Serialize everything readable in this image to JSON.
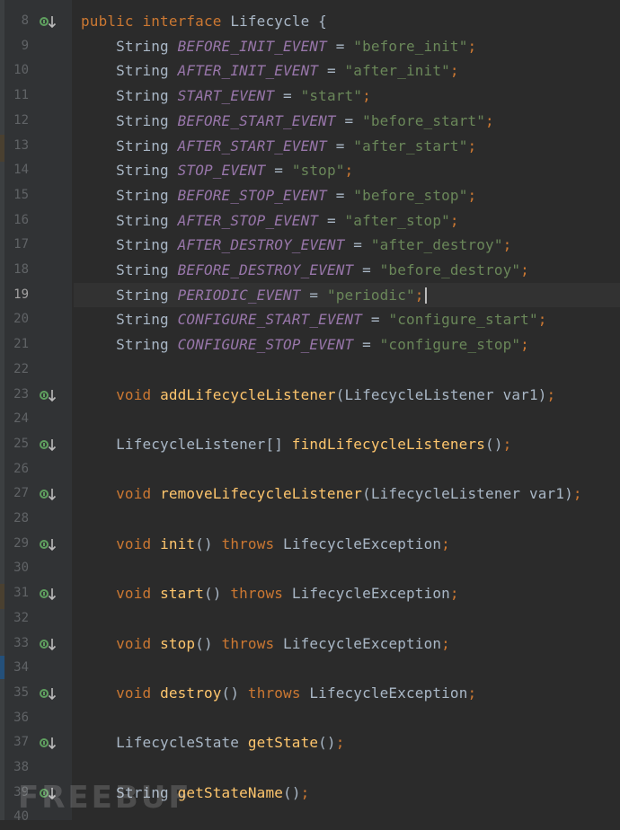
{
  "editor": {
    "current_line": "19",
    "lines": [
      {
        "num": "8",
        "marker": true,
        "tokens": [
          [
            "k",
            "public interface "
          ],
          [
            "t",
            "Lifecycle {"
          ]
        ]
      },
      {
        "num": "9",
        "tokens": [
          [
            "t",
            "    String "
          ],
          [
            "c",
            "BEFORE_INIT_EVENT"
          ],
          [
            "t",
            " = "
          ],
          [
            "s",
            "\"before_init\""
          ],
          [
            "p",
            ";"
          ]
        ]
      },
      {
        "num": "10",
        "tokens": [
          [
            "t",
            "    String "
          ],
          [
            "c",
            "AFTER_INIT_EVENT"
          ],
          [
            "t",
            " = "
          ],
          [
            "s",
            "\"after_init\""
          ],
          [
            "p",
            ";"
          ]
        ]
      },
      {
        "num": "11",
        "tokens": [
          [
            "t",
            "    String "
          ],
          [
            "c",
            "START_EVENT"
          ],
          [
            "t",
            " = "
          ],
          [
            "s",
            "\"start\""
          ],
          [
            "p",
            ";"
          ]
        ]
      },
      {
        "num": "12",
        "tokens": [
          [
            "t",
            "    String "
          ],
          [
            "c",
            "BEFORE_START_EVENT"
          ],
          [
            "t",
            " = "
          ],
          [
            "s",
            "\"before_start\""
          ],
          [
            "p",
            ";"
          ]
        ]
      },
      {
        "num": "13",
        "tokens": [
          [
            "t",
            "    String "
          ],
          [
            "c",
            "AFTER_START_EVENT"
          ],
          [
            "t",
            " = "
          ],
          [
            "s",
            "\"after_start\""
          ],
          [
            "p",
            ";"
          ]
        ]
      },
      {
        "num": "14",
        "tokens": [
          [
            "t",
            "    String "
          ],
          [
            "c",
            "STOP_EVENT"
          ],
          [
            "t",
            " = "
          ],
          [
            "s",
            "\"stop\""
          ],
          [
            "p",
            ";"
          ]
        ]
      },
      {
        "num": "15",
        "tokens": [
          [
            "t",
            "    String "
          ],
          [
            "c",
            "BEFORE_STOP_EVENT"
          ],
          [
            "t",
            " = "
          ],
          [
            "s",
            "\"before_stop\""
          ],
          [
            "p",
            ";"
          ]
        ]
      },
      {
        "num": "16",
        "tokens": [
          [
            "t",
            "    String "
          ],
          [
            "c",
            "AFTER_STOP_EVENT"
          ],
          [
            "t",
            " = "
          ],
          [
            "s",
            "\"after_stop\""
          ],
          [
            "p",
            ";"
          ]
        ]
      },
      {
        "num": "17",
        "tokens": [
          [
            "t",
            "    String "
          ],
          [
            "c",
            "AFTER_DESTROY_EVENT"
          ],
          [
            "t",
            " = "
          ],
          [
            "s",
            "\"after_destroy\""
          ],
          [
            "p",
            ";"
          ]
        ]
      },
      {
        "num": "18",
        "tokens": [
          [
            "t",
            "    String "
          ],
          [
            "c",
            "BEFORE_DESTROY_EVENT"
          ],
          [
            "t",
            " = "
          ],
          [
            "s",
            "\"before_destroy\""
          ],
          [
            "p",
            ";"
          ]
        ]
      },
      {
        "num": "19",
        "tokens": [
          [
            "t",
            "    String "
          ],
          [
            "c",
            "PERIODIC_EVENT"
          ],
          [
            "t",
            " = "
          ],
          [
            "s",
            "\"periodic\""
          ],
          [
            "p",
            ";"
          ]
        ]
      },
      {
        "num": "20",
        "tokens": [
          [
            "t",
            "    String "
          ],
          [
            "c",
            "CONFIGURE_START_EVENT"
          ],
          [
            "t",
            " = "
          ],
          [
            "s",
            "\"configure_start\""
          ],
          [
            "p",
            ";"
          ]
        ]
      },
      {
        "num": "21",
        "tokens": [
          [
            "t",
            "    String "
          ],
          [
            "c",
            "CONFIGURE_STOP_EVENT"
          ],
          [
            "t",
            " = "
          ],
          [
            "s",
            "\"configure_stop\""
          ],
          [
            "p",
            ";"
          ]
        ]
      },
      {
        "num": "22",
        "tokens": []
      },
      {
        "num": "23",
        "marker": true,
        "tokens": [
          [
            "t",
            "    "
          ],
          [
            "k",
            "void "
          ],
          [
            "m",
            "addLifecycleListener"
          ],
          [
            "t",
            "(LifecycleListener var1)"
          ],
          [
            "p",
            ";"
          ]
        ]
      },
      {
        "num": "24",
        "tokens": []
      },
      {
        "num": "25",
        "marker": true,
        "tokens": [
          [
            "t",
            "    LifecycleListener[] "
          ],
          [
            "m",
            "findLifecycleListeners"
          ],
          [
            "t",
            "()"
          ],
          [
            "p",
            ";"
          ]
        ]
      },
      {
        "num": "26",
        "tokens": []
      },
      {
        "num": "27",
        "marker": true,
        "tokens": [
          [
            "t",
            "    "
          ],
          [
            "k",
            "void "
          ],
          [
            "m",
            "removeLifecycleListener"
          ],
          [
            "t",
            "(LifecycleListener var1)"
          ],
          [
            "p",
            ";"
          ]
        ]
      },
      {
        "num": "28",
        "tokens": []
      },
      {
        "num": "29",
        "marker": true,
        "tokens": [
          [
            "t",
            "    "
          ],
          [
            "k",
            "void "
          ],
          [
            "m",
            "init"
          ],
          [
            "t",
            "() "
          ],
          [
            "k",
            "throws "
          ],
          [
            "t",
            "LifecycleException"
          ],
          [
            "p",
            ";"
          ]
        ]
      },
      {
        "num": "30",
        "tokens": []
      },
      {
        "num": "31",
        "marker": true,
        "tokens": [
          [
            "t",
            "    "
          ],
          [
            "k",
            "void "
          ],
          [
            "m",
            "start"
          ],
          [
            "t",
            "() "
          ],
          [
            "k",
            "throws "
          ],
          [
            "t",
            "LifecycleException"
          ],
          [
            "p",
            ";"
          ]
        ]
      },
      {
        "num": "32",
        "tokens": []
      },
      {
        "num": "33",
        "marker": true,
        "tokens": [
          [
            "t",
            "    "
          ],
          [
            "k",
            "void "
          ],
          [
            "m",
            "stop"
          ],
          [
            "t",
            "() "
          ],
          [
            "k",
            "throws "
          ],
          [
            "t",
            "LifecycleException"
          ],
          [
            "p",
            ";"
          ]
        ]
      },
      {
        "num": "34",
        "tokens": []
      },
      {
        "num": "35",
        "marker": true,
        "tokens": [
          [
            "t",
            "    "
          ],
          [
            "k",
            "void "
          ],
          [
            "m",
            "destroy"
          ],
          [
            "t",
            "() "
          ],
          [
            "k",
            "throws "
          ],
          [
            "t",
            "LifecycleException"
          ],
          [
            "p",
            ";"
          ]
        ]
      },
      {
        "num": "36",
        "tokens": []
      },
      {
        "num": "37",
        "marker": true,
        "tokens": [
          [
            "t",
            "    LifecycleState "
          ],
          [
            "m",
            "getState"
          ],
          [
            "t",
            "()"
          ],
          [
            "p",
            ";"
          ]
        ]
      },
      {
        "num": "38",
        "tokens": []
      },
      {
        "num": "39",
        "marker": true,
        "tokens": [
          [
            "t",
            "    String "
          ],
          [
            "m",
            "getStateName"
          ],
          [
            "t",
            "()"
          ],
          [
            "p",
            ";"
          ]
        ]
      },
      {
        "num": "40",
        "tokens": []
      }
    ]
  },
  "colors": {
    "background": "#2b2b2b",
    "keyword": "#cc7832",
    "constant": "#9876aa",
    "string": "#6a8759",
    "method": "#ffc66d",
    "text": "#a9b7c6",
    "marker": "#5fa05f"
  },
  "icons": {
    "gutter_marker": "implementation-down-arrow-icon"
  },
  "watermark": "FREEBUF"
}
